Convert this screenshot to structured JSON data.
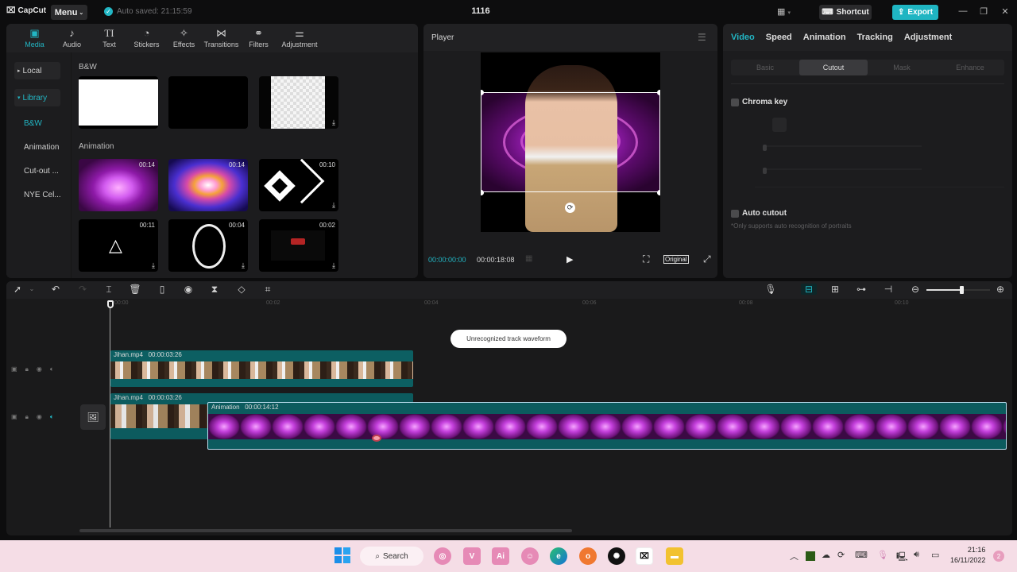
{
  "titlebar": {
    "app_name": "CapCut",
    "menu_label": "Menu",
    "autosave_text": "Auto saved: 21:15:59",
    "project_title": "1116",
    "shortcut_label": "Shortcut",
    "export_label": "Export",
    "accent_color": "#22b6c4"
  },
  "media": {
    "tabs": [
      {
        "label": "Media",
        "icon": "media-icon",
        "active": true
      },
      {
        "label": "Audio",
        "icon": "audio-icon"
      },
      {
        "label": "Text",
        "icon": "text-icon"
      },
      {
        "label": "Stickers",
        "icon": "stickers-icon"
      },
      {
        "label": "Effects",
        "icon": "effects-icon"
      },
      {
        "label": "Transitions",
        "icon": "transitions-icon"
      },
      {
        "label": "Filters",
        "icon": "filters-icon"
      },
      {
        "label": "Adjustment",
        "icon": "adjustment-icon"
      }
    ],
    "side_nav": [
      {
        "label": "Local",
        "prefix": "▸"
      },
      {
        "label": "Library",
        "prefix": "▾",
        "active": true
      },
      {
        "label": "B&W",
        "active": true
      },
      {
        "label": "Animation"
      },
      {
        "label": "Cut-out ..."
      },
      {
        "label": "NYE Cel..."
      }
    ],
    "sections": {
      "bw": "B&W",
      "animation": "Animation"
    },
    "bw_items": [
      {
        "name": "white"
      },
      {
        "name": "black"
      },
      {
        "name": "transparent",
        "download": true
      }
    ],
    "animation_items": [
      {
        "duration": "00:14",
        "name": "pink-heart-tunnel"
      },
      {
        "duration": "00:14",
        "name": "rainbow-heart-tunnel"
      },
      {
        "duration": "00:10",
        "name": "white-diamonds",
        "download": true
      },
      {
        "duration": "00:11",
        "name": "triangle",
        "download": true
      },
      {
        "duration": "00:04",
        "name": "circle-ring",
        "download": true
      },
      {
        "duration": "00:02",
        "name": "battery",
        "download": true
      }
    ]
  },
  "player": {
    "title": "Player",
    "current_time": "00:00:00:00",
    "total_time": "00:00:18:08",
    "ratio_label": "Original"
  },
  "props": {
    "tabs": [
      {
        "label": "Video",
        "active": true
      },
      {
        "label": "Speed"
      },
      {
        "label": "Animation"
      },
      {
        "label": "Tracking"
      },
      {
        "label": "Adjustment"
      }
    ],
    "subtabs": [
      {
        "label": "Basic"
      },
      {
        "label": "Cutout",
        "active": true
      },
      {
        "label": "Mask"
      },
      {
        "label": "Enhance"
      }
    ],
    "chroma_key_label": "Chroma key",
    "auto_cutout_label": "Auto cutout",
    "auto_cutout_note": "*Only supports auto recognition of portraits"
  },
  "timeline": {
    "ruler_labels": [
      "00:00",
      "00:02",
      "00:04",
      "00:06",
      "00:08",
      "00:10"
    ],
    "tooltip": "Unrecognized track waveform",
    "clips": [
      {
        "name": "Jihan.mp4",
        "duration": "00:00:03:26",
        "track": 1
      },
      {
        "name": "Jihan.mp4",
        "duration": "00:00:03:26",
        "track": 2
      },
      {
        "name": "Animation",
        "duration": "00:00:14:12",
        "track": 2
      }
    ],
    "zoom_level": 0.55
  },
  "taskbar": {
    "search_label": "Search",
    "time": "21:16",
    "date": "16/11/2022",
    "notifications": "2"
  }
}
